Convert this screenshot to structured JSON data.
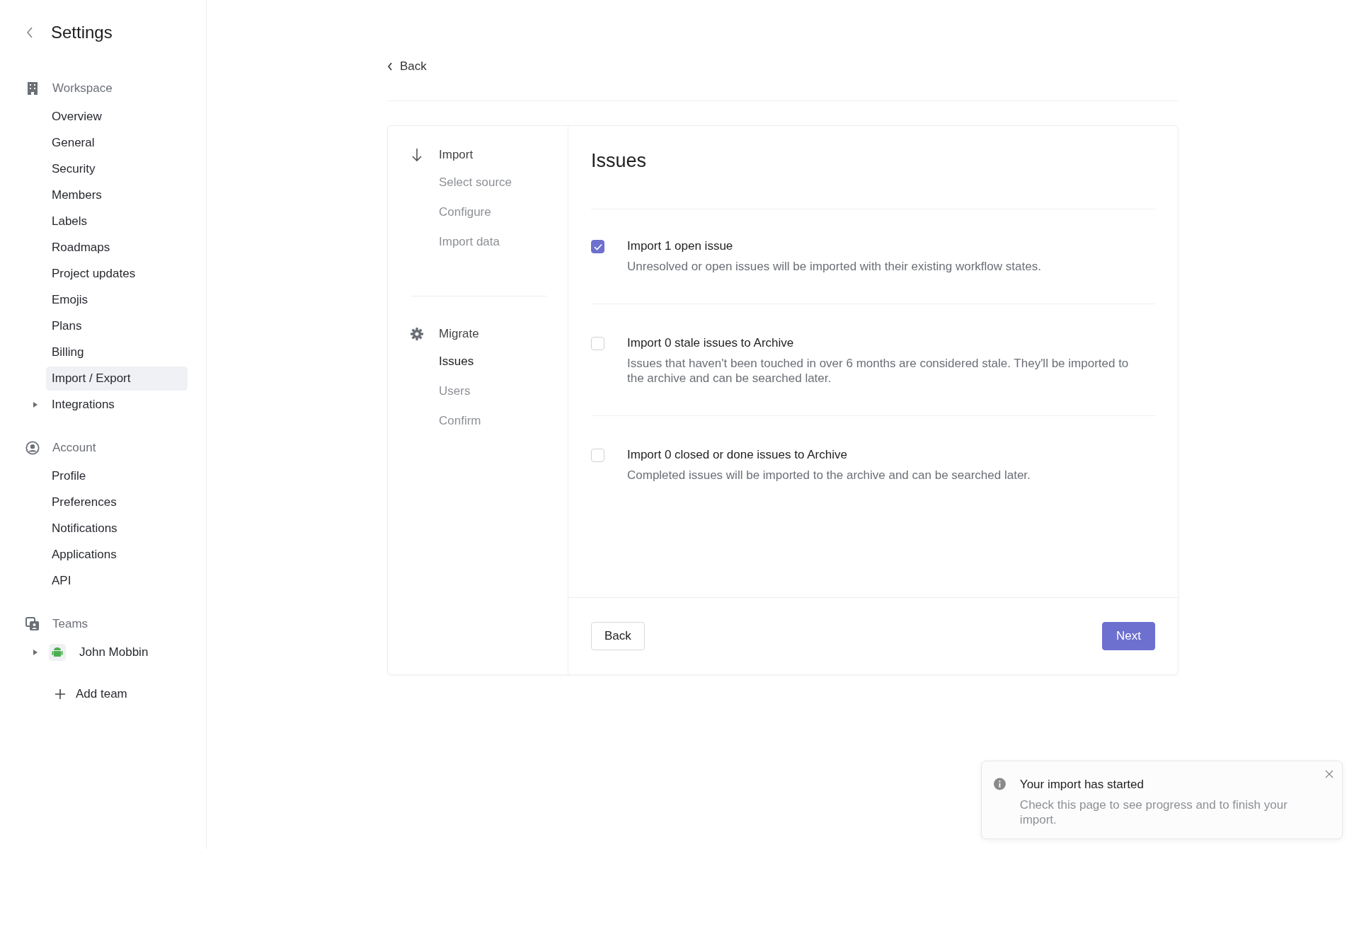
{
  "sidebar": {
    "title": "Settings",
    "sections": [
      {
        "kind": "workspace",
        "label": "Workspace",
        "items": [
          {
            "label": "Overview",
            "selected": false
          },
          {
            "label": "General",
            "selected": false
          },
          {
            "label": "Security",
            "selected": false
          },
          {
            "label": "Members",
            "selected": false
          },
          {
            "label": "Labels",
            "selected": false
          },
          {
            "label": "Roadmaps",
            "selected": false
          },
          {
            "label": "Project updates",
            "selected": false
          },
          {
            "label": "Emojis",
            "selected": false
          },
          {
            "label": "Plans",
            "selected": false
          },
          {
            "label": "Billing",
            "selected": false
          },
          {
            "label": "Import / Export",
            "selected": true
          },
          {
            "label": "Integrations",
            "selected": false,
            "expandable": true
          }
        ]
      },
      {
        "kind": "account",
        "label": "Account",
        "items": [
          {
            "label": "Profile",
            "selected": false
          },
          {
            "label": "Preferences",
            "selected": false
          },
          {
            "label": "Notifications",
            "selected": false
          },
          {
            "label": "Applications",
            "selected": false
          },
          {
            "label": "API",
            "selected": false
          }
        ]
      },
      {
        "kind": "teams",
        "label": "Teams",
        "items": [
          {
            "label": "John Mobbin",
            "selected": false,
            "expandable": true,
            "team": true
          }
        ]
      }
    ],
    "add_team": "Add team"
  },
  "back_link": "Back",
  "steps": [
    {
      "kind": "import",
      "label": "Import",
      "items": [
        {
          "label": "Select source",
          "selected": false
        },
        {
          "label": "Configure",
          "selected": false
        },
        {
          "label": "Import data",
          "selected": false
        }
      ]
    },
    {
      "kind": "migrate",
      "label": "Migrate",
      "items": [
        {
          "label": "Issues",
          "selected": true
        },
        {
          "label": "Users",
          "selected": false
        },
        {
          "label": "Confirm",
          "selected": false
        }
      ]
    }
  ],
  "panel": {
    "title": "Issues",
    "options": [
      {
        "title": "Import 1 open issue",
        "description": "Unresolved or open issues will be imported with their existing workflow states.",
        "checked": true
      },
      {
        "title": "Import 0 stale issues to Archive",
        "description": "Issues that haven't been touched in over 6 months are considered stale. They'll be imported to the archive and can be searched later.",
        "checked": false
      },
      {
        "title": "Import 0 closed or done issues to Archive",
        "description": "Completed issues will be imported to the archive and can be searched later.",
        "checked": false
      }
    ],
    "back_button": "Back",
    "next_button": "Next"
  },
  "toast": {
    "title": "Your import has started",
    "message": "Check this page to see progress and to finish your import."
  }
}
